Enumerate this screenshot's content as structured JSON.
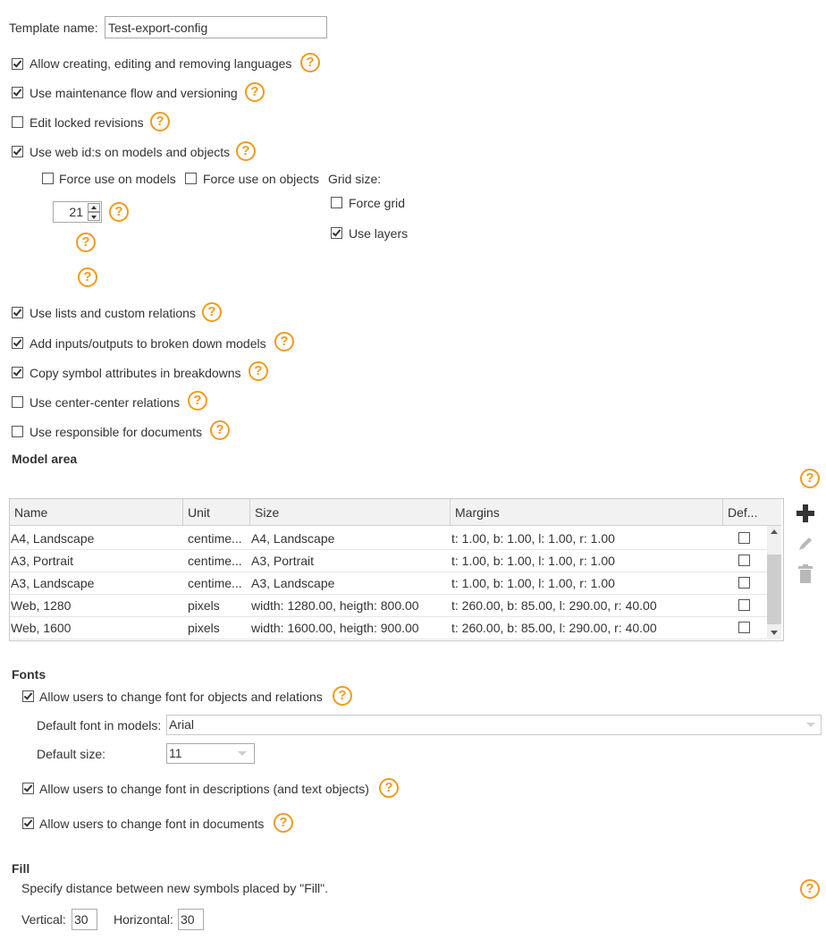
{
  "template": {
    "label": "Template name:",
    "value": "Test-export-config"
  },
  "options": {
    "allow_languages": "Allow creating, editing and removing languages",
    "maintenance_flow": "Use maintenance flow and versioning",
    "edit_locked": "Edit locked revisions",
    "web_ids": "Use web id:s on models and objects",
    "force_models": "Force use on models",
    "force_objects": "Force use on objects",
    "grid_size": "Grid size:",
    "grid_value": "21",
    "force_grid": "Force grid",
    "use_layers": "Use layers",
    "lists_relations": "Use lists and custom relations",
    "inputs_outputs": "Add inputs/outputs to broken down models",
    "copy_symbol": "Copy symbol attributes in breakdowns",
    "center_center": "Use center-center relations",
    "responsible_docs": "Use responsible for documents"
  },
  "model_area": {
    "title": "Model area",
    "columns": [
      "Name",
      "Unit",
      "Size",
      "Margins",
      "Def..."
    ],
    "rows": [
      {
        "name": "A4, Landscape",
        "unit": "centime...",
        "size": "A4, Landscape",
        "margins": "t: 1.00, b: 1.00, l: 1.00, r: 1.00"
      },
      {
        "name": "A3, Portrait",
        "unit": "centime...",
        "size": "A3, Portrait",
        "margins": "t: 1.00, b: 1.00, l: 1.00, r: 1.00"
      },
      {
        "name": "A3, Landscape",
        "unit": "centime...",
        "size": "A3, Landscape",
        "margins": "t: 1.00, b: 1.00, l: 1.00, r: 1.00"
      },
      {
        "name": "Web, 1280",
        "unit": "pixels",
        "size": "width: 1280.00, heigth: 800.00",
        "margins": "t: 260.00, b: 85.00, l: 290.00, r: 40.00"
      },
      {
        "name": "Web, 1600",
        "unit": "pixels",
        "size": "width: 1600.00, heigth: 900.00",
        "margins": "t: 260.00, b: 85.00, l: 290.00, r: 40.00"
      }
    ]
  },
  "fonts": {
    "title": "Fonts",
    "allow_objects": "Allow users to change font for objects and relations",
    "default_font_label": "Default font in models:",
    "default_font_value": "Arial",
    "default_size_label": "Default size:",
    "default_size_value": "11",
    "allow_descriptions": "Allow users to change font in descriptions (and text objects)",
    "allow_documents": "Allow users to change font in documents"
  },
  "fill": {
    "title": "Fill",
    "description": "Specify distance between new symbols placed by \"Fill\".",
    "vertical_label": "Vertical:",
    "vertical_value": "30",
    "horizontal_label": "Horizontal:",
    "horizontal_value": "30"
  },
  "icons": {
    "help": "question-circle-icon",
    "add": "plus-icon",
    "edit": "pencil-icon",
    "delete": "trash-icon",
    "help_glyph": "?"
  },
  "colors": {
    "help_orange": "#f39a1e",
    "accent_gray": "#333333"
  }
}
